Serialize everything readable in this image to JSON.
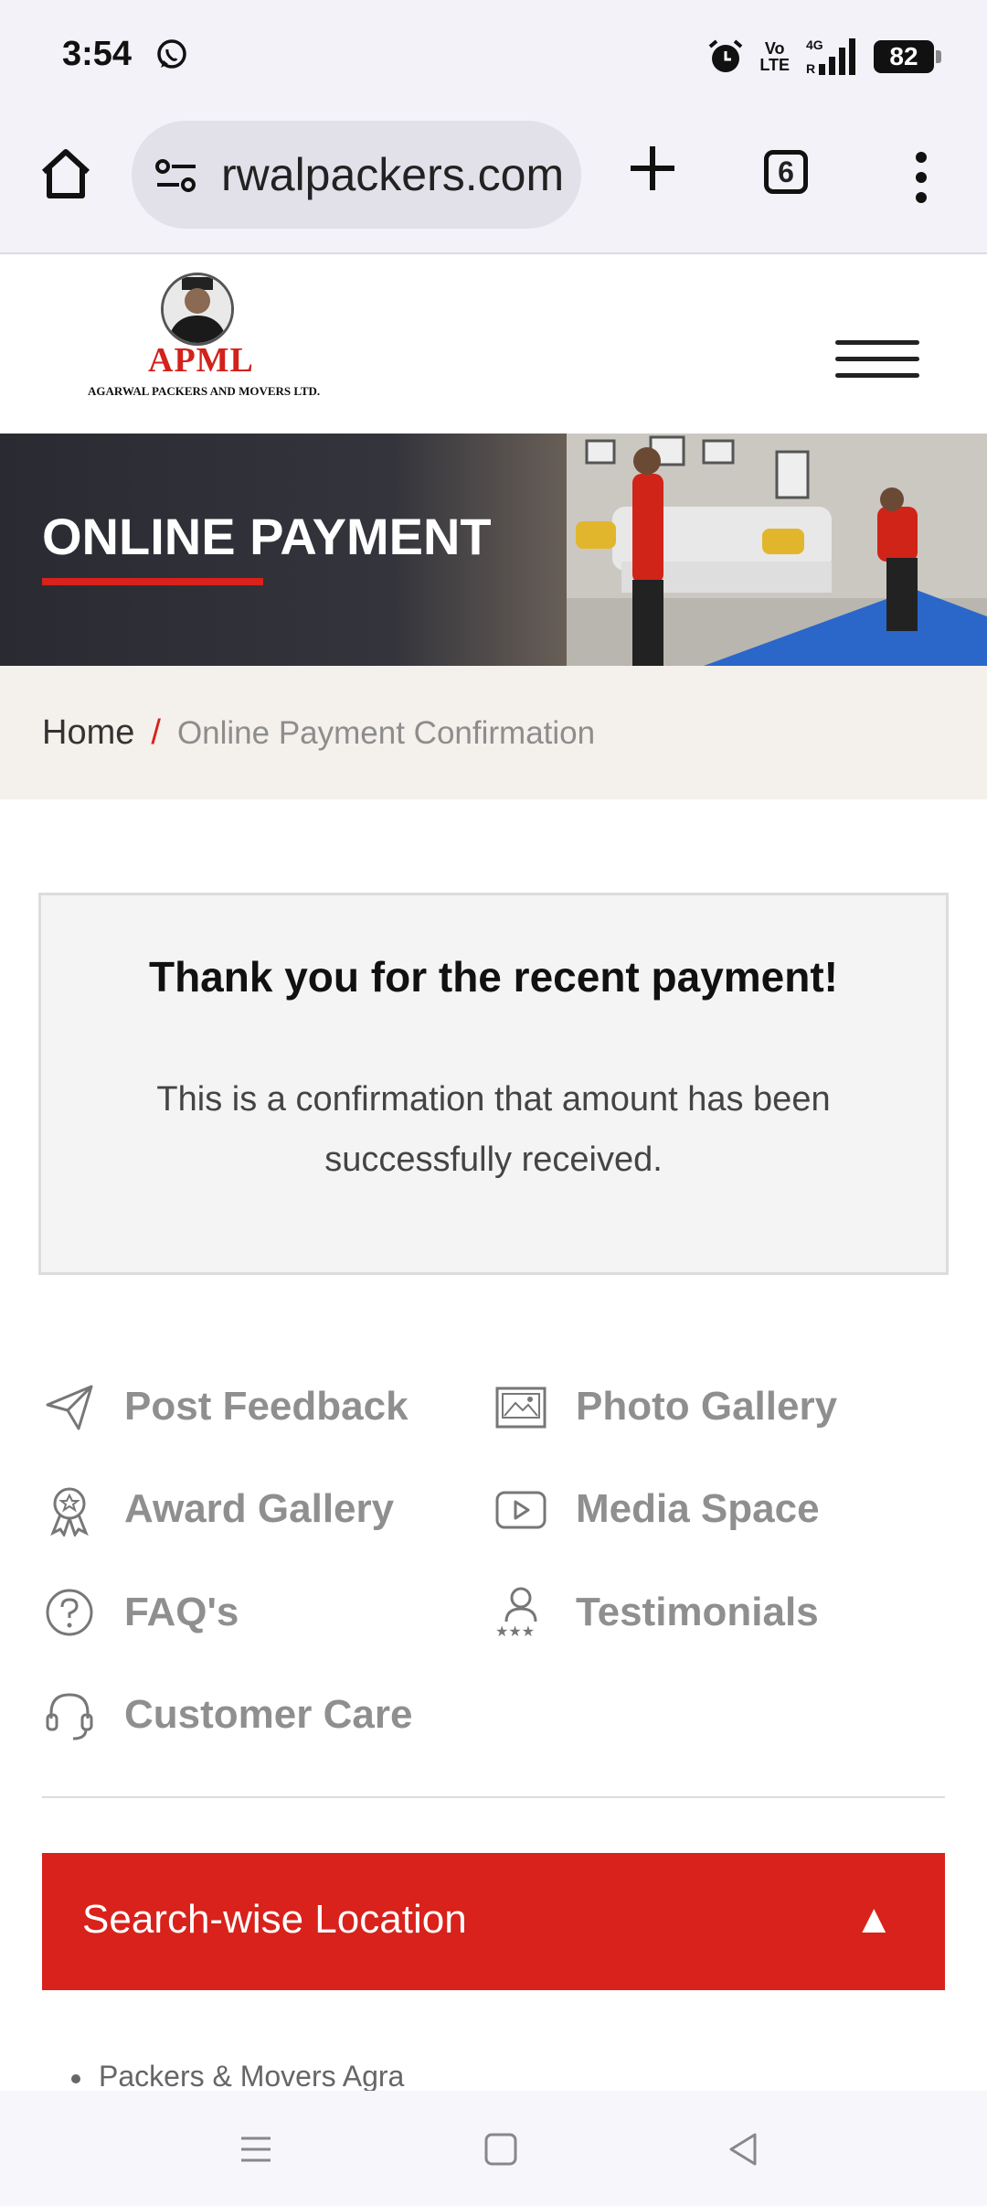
{
  "status_bar": {
    "time": "3:54",
    "volte_top": "Vo",
    "volte_bottom": "LTE",
    "network": "4G",
    "battery": "82",
    "icons": [
      "whatsapp-icon",
      "alarm-icon",
      "signal-icon",
      "battery-icon"
    ]
  },
  "browser": {
    "url": "rwalpackers.com",
    "tab_count": "6",
    "icons": [
      "home-icon",
      "site-settings-icon",
      "plus-icon",
      "tabs-icon",
      "more-vert-icon"
    ]
  },
  "header": {
    "logo_text": "APML",
    "logo_subtitle": "AGARWAL PACKERS AND MOVERS LTD."
  },
  "banner": {
    "title": "ONLINE PAYMENT"
  },
  "breadcrumb": {
    "home": "Home",
    "separator": "/",
    "current": "Online Payment Confirmation"
  },
  "confirmation": {
    "title": "Thank you for the recent payment!",
    "message": "This is a confirmation that amount has been successfully received."
  },
  "quick_links": [
    {
      "label": "Post Feedback",
      "icon": "paper-plane-icon"
    },
    {
      "label": "Photo Gallery",
      "icon": "image-icon"
    },
    {
      "label": "Award Gallery",
      "icon": "award-icon"
    },
    {
      "label": "Media Space",
      "icon": "play-icon"
    },
    {
      "label": "FAQ's",
      "icon": "question-icon"
    },
    {
      "label": "Testimonials",
      "icon": "user-stars-icon"
    },
    {
      "label": "Customer Care",
      "icon": "headset-icon"
    }
  ],
  "accordion": {
    "label": "Search-wise Location",
    "arrow": "▲"
  },
  "locations": [
    "Packers & Movers Agra"
  ],
  "colors": {
    "brand_red": "#d8221b",
    "chrome_bg": "#f3f2f9",
    "link_gray": "#8f8f8f"
  }
}
